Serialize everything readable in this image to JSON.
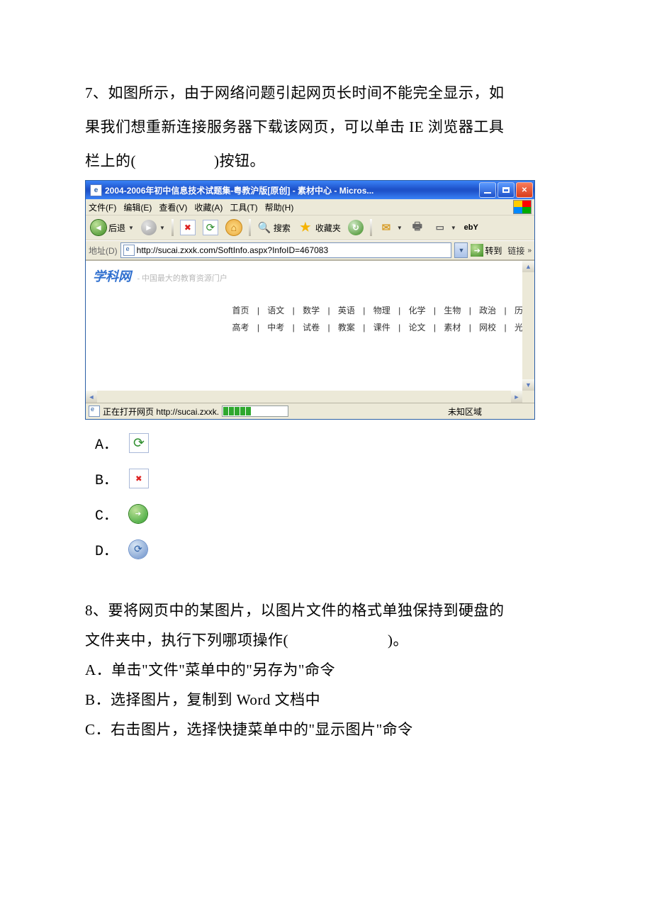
{
  "q7": {
    "text_line1": "7、如图所示，由于网络问题引起网页长时间不能完全显示，如",
    "text_line2": "果我们想重新连接服务器下载该网页，可以单击 IE 浏览器工具",
    "text_line3_pre": "栏上的(",
    "text_line3_post": ")按钮。"
  },
  "ie": {
    "title": "2004-2006年初中信息技术试题集-粤教沪版[原创] - 素材中心 - Micros...",
    "menu": {
      "file": "文件(F)",
      "edit": "编辑(E)",
      "view": "查看(V)",
      "fav": "收藏(A)",
      "tools": "工具(T)",
      "help": "帮助(H)"
    },
    "toolbar": {
      "back": "后退",
      "search": "搜索",
      "fav": "收藏夹",
      "ebay": "ebY"
    },
    "addr": {
      "label": "地址(D)",
      "url": "http://sucai.zxxk.com/SoftInfo.aspx?InfoID=467083",
      "go": "转到",
      "links": "链接"
    },
    "content": {
      "logo": "学科网",
      "logosub": "- 中国最大的教育资源门户",
      "nav1": [
        "首页",
        "语文",
        "数学",
        "英语",
        "物理",
        "化学",
        "生物",
        "政治",
        "历"
      ],
      "nav2": [
        "高考",
        "中考",
        "试卷",
        "教案",
        "课件",
        "论文",
        "素材",
        "网校",
        "光"
      ]
    },
    "status": {
      "loading": "正在打开网页 http://sucai.zxxk.",
      "zone": "未知区域"
    }
  },
  "options": {
    "a": "A．",
    "b": "B．",
    "c": "C．",
    "d": "D．"
  },
  "q8": {
    "l1": "8、要将网页中的某图片，以图片文件的格式单独保持到硬盘的",
    "l2_pre": "文件夹中，执行下列哪项操作(",
    "l2_post": ")。",
    "a": "A．单击\"文件\"菜单中的\"另存为\"命令",
    "b": "B．选择图片，复制到 Word 文档中",
    "c": "C．右击图片，选择快捷菜单中的\"显示图片\"命令"
  }
}
